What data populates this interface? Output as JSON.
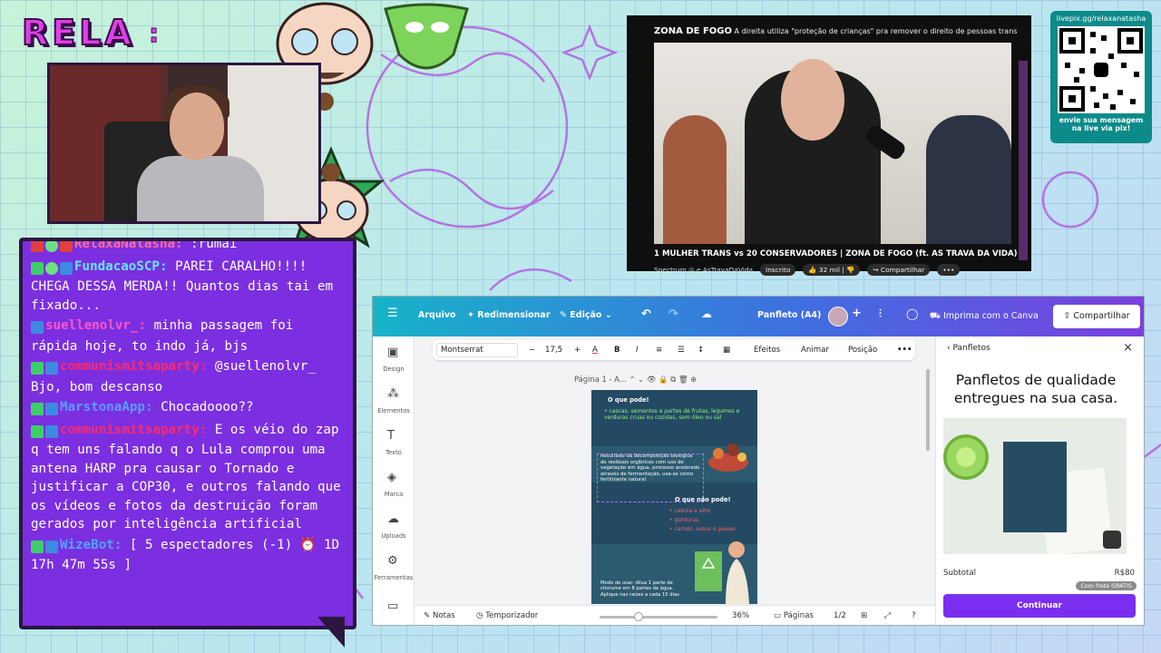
{
  "overlay": {
    "brand": "RELA",
    "brand_colon": ":",
    "accent_color": "#e040e8",
    "chat_bg": "#7b2fe0"
  },
  "chat": {
    "messages": [
      {
        "user": "RelaxaNatasha",
        "user_color": "#ff6b9a",
        "badges": [
          "red",
          "alien",
          "red"
        ],
        "text": ":rumai"
      },
      {
        "user": "FundacaoSCP",
        "user_color": "#62e8ff",
        "badges": [
          "green",
          "alien",
          "blue"
        ],
        "text": "PAREI CARALHO!!!! CHEGA DESSA MERDA!! Quantos dias tai em fixado..."
      },
      {
        "user": "suellenolvr_",
        "user_color": "#ff55c8",
        "badges": [
          "blue"
        ],
        "text": "minha passagem foi rápida hoje, to indo já, bjs"
      },
      {
        "user": "communismitsaparty",
        "user_color": "#ff2b6b",
        "badges": [
          "green",
          "blue"
        ],
        "text": "@suellenolvr_ Bjo, bom descanso"
      },
      {
        "user": "MarstonaApp",
        "user_color": "#5a9cff",
        "badges": [
          "green",
          "blue"
        ],
        "text": "Chocadoooo??"
      },
      {
        "user": "communismitsaparty",
        "user_color": "#ff2b6b",
        "badges": [
          "green",
          "blue"
        ],
        "text": "E os véio do zap q tem uns falando q o Lula comprou uma antena HARP pra causar o Tornado e justificar a COP30, e outros falando que os vídeos e fotos da destruição foram gerados por inteligência artificial"
      },
      {
        "user": "WizeBot",
        "user_color": "#4aa8ff",
        "badges": [
          "green",
          "blue"
        ],
        "text": "[ 5 espectadores (-1) ⏰ 1D 17h 47m 55s ]"
      }
    ]
  },
  "youtube": {
    "channel_logo": "ZONA DE FOGO",
    "headline": "A direita utiliza \"proteção de crianças\" pra remover o direito de pessoas trans",
    "title": "1 MULHER TRANS vs 20 CONSERVADORES | ZONA DE FOGO (ft. AS TRAVA DA VIDA)",
    "channel": "Spectrum ◎ e AsTravaDaVida",
    "subscribe": "Inscrito",
    "likes": "32 mil",
    "share": "Compartilhar",
    "more": "•••"
  },
  "qr": {
    "url": "livepix.gg/relaxanatasha",
    "note": "envie sua mensagem na live via pix!"
  },
  "canva": {
    "menu": {
      "hamburger": "☰",
      "file": "Arquivo",
      "resize": "Redimensionar",
      "edit": "Edição",
      "undo": "↶",
      "redo": "↷",
      "doc_title": "Panfleto (A4)",
      "print": "Imprima com o Canva",
      "share": "Compartilhar"
    },
    "sidebar": [
      {
        "label": "Design",
        "icon": "layout-icon"
      },
      {
        "label": "Elementos",
        "icon": "shapes-icon"
      },
      {
        "label": "Texto",
        "icon": "text-icon"
      },
      {
        "label": "Marca",
        "icon": "brand-icon"
      },
      {
        "label": "Uploads",
        "icon": "upload-icon"
      },
      {
        "label": "Ferramentas",
        "icon": "tools-icon"
      }
    ],
    "toolbar": {
      "font": "Montserrat",
      "font_size": "17,5",
      "bold": "B",
      "italic": "I",
      "effects": "Efeitos",
      "animate": "Animar",
      "position": "Posição",
      "more": "•••"
    },
    "page_label": "Página 1 - A...",
    "page_content": {
      "heading_ok": "O que pode!",
      "ok_text": "• cascas, sementes e partes de frutas, legumes e verduras cruas ou cozidas, sem óleo ou sal",
      "body": "Resultado da decomposição biológica de resíduos orgânicos com uso de vegetação em água, processo acelerado através de fermentação, usa-se como fertilizante natural",
      "heading_bad": "O que não pode!",
      "bad_items": [
        "• cebola e alho",
        "• gorduras",
        "• carnes, ossos e peixes"
      ],
      "footer": "Modo de usar: dilua 1 parte de chorume em 8 partes de água. Aplique nas raízes a cada 15 dias"
    },
    "bottom": {
      "notes": "Notas",
      "timer": "Temporizador",
      "zoom": "36%",
      "pages": "Páginas",
      "page_count": "1/2",
      "help": "?"
    },
    "panel": {
      "title": "Panfletos",
      "headline": "Panfletos de qualidade entregues na sua casa.",
      "subtotal_label": "Subtotal",
      "price": "R$80",
      "shipping": "Com frete GRÁTIS",
      "continue": "Continuar"
    }
  }
}
